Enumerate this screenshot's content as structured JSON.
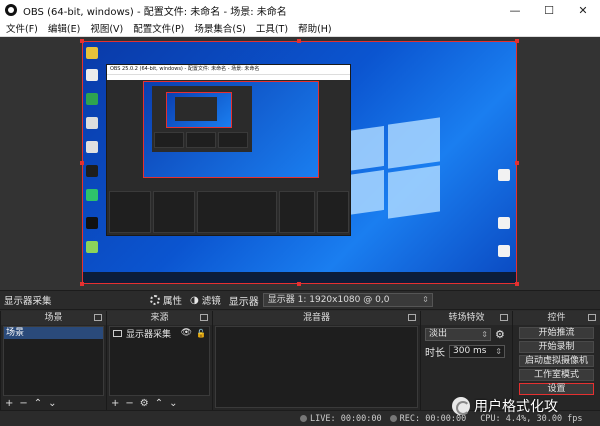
{
  "window": {
    "title": "OBS        (64-bit, windows) - 配置文件: 未命名 - 场景: 未命名",
    "minimize": "—",
    "maximize": "☐",
    "close": "✕"
  },
  "menu": [
    "文件(F)",
    "编辑(E)",
    "视图(V)",
    "配置文件(P)",
    "场景集合(S)",
    "工具(T)",
    "帮助(H)"
  ],
  "sourcebar": {
    "source_name": "显示器采集",
    "properties": "属性",
    "filters": "滤镜",
    "display_label": "显示器",
    "display_value": "显示器 1: 1920x1080 @ 0,0"
  },
  "docks": {
    "scenes": {
      "title": "场景",
      "items": [
        "场景"
      ]
    },
    "sources": {
      "title": "来源",
      "items": [
        "显示器采集"
      ]
    },
    "mixer": {
      "title": "混音器"
    },
    "transitions": {
      "title": "转场特效",
      "transition": "淡出",
      "duration_label": "时长",
      "duration_value": "300 ms"
    },
    "controls": {
      "title": "控件",
      "buttons": [
        "开始推流",
        "开始录制",
        "启动虚拟摄像机",
        "工作室模式",
        "设置"
      ]
    }
  },
  "status": {
    "live": "LIVE: 00:00:00",
    "rec": "REC: 00:00:00",
    "cpu": "CPU: 4.4%, 30.00 fps"
  },
  "watermark": "用户格式化攻",
  "nested": {
    "title": "OBS 25.0.2 (64-bit, windows) - 配置文件: 未命名 - 场景: 未命名"
  }
}
